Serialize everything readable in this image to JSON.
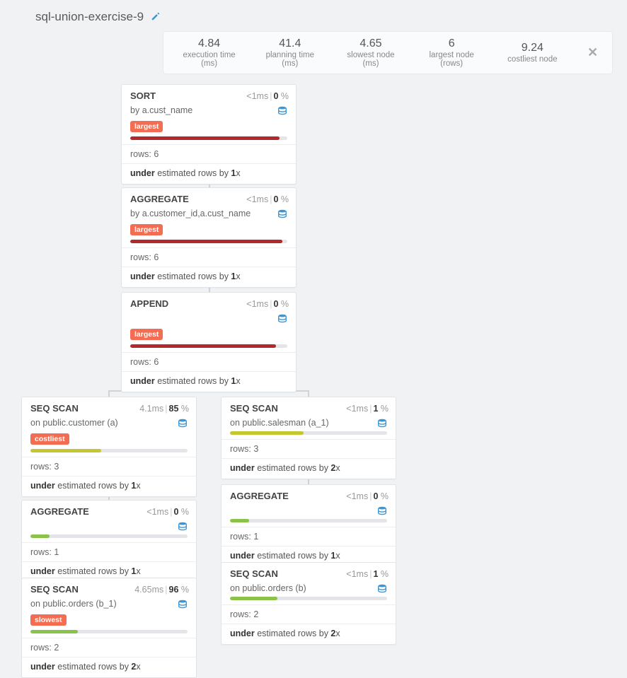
{
  "page_title": "sql-union-exercise-9",
  "stats": {
    "exec_val": "4.84",
    "exec_lbl": "execution time (ms)",
    "plan_val": "41.4",
    "plan_lbl": "planning time (ms)",
    "slow_val": "4.65",
    "slow_lbl": "slowest node (ms)",
    "large_val": "6",
    "large_lbl": "largest node (rows)",
    "cost_val": "9.24",
    "cost_lbl": "costliest node"
  },
  "labels": {
    "rows_prefix": "rows: ",
    "under_a": "under",
    "under_b": " estimated rows by ",
    "under_c": "x",
    "ms": "ms",
    "pct": " %",
    "by": "by ",
    "on": "on "
  },
  "tags": {
    "largest": "largest",
    "costliest": "costliest",
    "slowest": "slowest"
  },
  "nodes": {
    "sort": {
      "title": "SORT",
      "time": "<1",
      "pct": "0",
      "sub": "a.cust_name",
      "rows": "6",
      "factor": "1"
    },
    "agg1": {
      "title": "AGGREGATE",
      "time": "<1",
      "pct": "0",
      "sub": "a.customer_id,a.cust_name",
      "rows": "6",
      "factor": "1"
    },
    "append": {
      "title": "APPEND",
      "time": "<1",
      "pct": "0",
      "rows": "6",
      "factor": "1"
    },
    "seqL1": {
      "title": "SEQ SCAN",
      "time": "4.1",
      "pct": "85",
      "sub": "public.customer (a)",
      "rows": "3",
      "factor": "1"
    },
    "seqR1": {
      "title": "SEQ SCAN",
      "time": "<1",
      "pct": "1",
      "sub": "public.salesman (a_1)",
      "rows": "3",
      "factor": "2"
    },
    "aggL": {
      "title": "AGGREGATE",
      "time": "<1",
      "pct": "0",
      "rows": "1",
      "factor": "1"
    },
    "aggR": {
      "title": "AGGREGATE",
      "time": "<1",
      "pct": "0",
      "rows": "1",
      "factor": "1"
    },
    "seqL2": {
      "title": "SEQ SCAN",
      "time": "4.65",
      "pct": "96",
      "sub": "public.orders (b_1)",
      "rows": "2",
      "factor": "2"
    },
    "seqR2": {
      "title": "SEQ SCAN",
      "time": "<1",
      "pct": "1",
      "sub": "public.orders (b)",
      "rows": "2",
      "factor": "2"
    }
  }
}
